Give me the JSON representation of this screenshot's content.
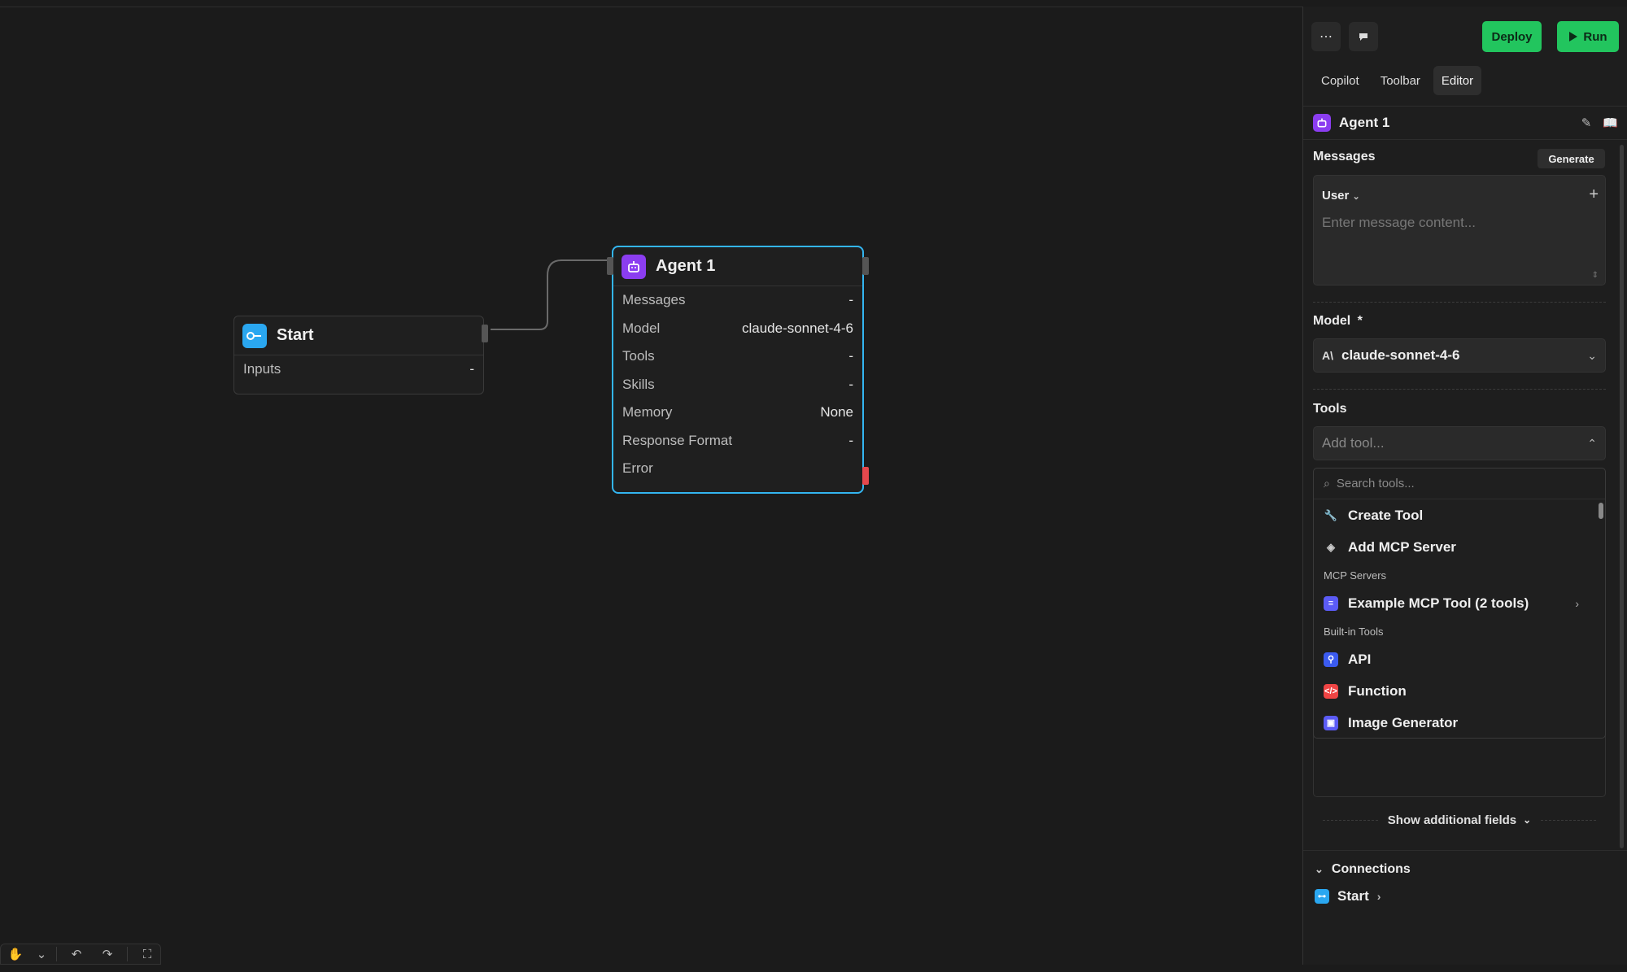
{
  "canvas": {
    "start_node": {
      "title": "Start",
      "rows": [
        {
          "label": "Inputs",
          "value": "-"
        }
      ]
    },
    "agent_node": {
      "title": "Agent 1",
      "rows": [
        {
          "label": "Messages",
          "value": "-"
        },
        {
          "label": "Model",
          "value": "claude-sonnet-4-6"
        },
        {
          "label": "Tools",
          "value": "-"
        },
        {
          "label": "Skills",
          "value": "-"
        },
        {
          "label": "Memory",
          "value": "None"
        },
        {
          "label": "Response Format",
          "value": "-"
        },
        {
          "label": "Error",
          "value": ""
        }
      ]
    }
  },
  "panel": {
    "top": {
      "deploy_label": "Deploy",
      "run_label": "Run"
    },
    "tabs": [
      {
        "label": "Copilot"
      },
      {
        "label": "Toolbar"
      },
      {
        "label": "Editor"
      }
    ],
    "active_tab": "Editor",
    "header": {
      "title": "Agent 1"
    },
    "messages": {
      "label": "Messages",
      "generate_label": "Generate",
      "role": "User",
      "placeholder": "Enter message content..."
    },
    "model": {
      "label": "Model",
      "required_mark": "*",
      "value": "claude-sonnet-4-6"
    },
    "tools": {
      "label": "Tools",
      "placeholder": "Add tool...",
      "search_placeholder": "Search tools...",
      "actions": [
        {
          "label": "Create Tool",
          "icon": "wrench-icon"
        },
        {
          "label": "Add MCP Server",
          "icon": "mcp-icon"
        }
      ],
      "mcp_section_label": "MCP Servers",
      "mcp_servers": [
        {
          "label": "Example MCP Tool (2 tools)"
        }
      ],
      "builtin_section_label": "Built-in Tools",
      "builtin_tools": [
        {
          "label": "API",
          "color": "#3b5bf0"
        },
        {
          "label": "Function",
          "color": "#ef4444"
        },
        {
          "label": "Image Generator",
          "color": "#5b5bf5"
        }
      ]
    },
    "show_additional_fields_label": "Show additional fields",
    "connections": {
      "label": "Connections",
      "items": [
        {
          "label": "Start"
        }
      ]
    }
  },
  "colors": {
    "accent_green": "#22c55e",
    "agent_purple": "#8b3df0",
    "start_blue": "#2aa7f0",
    "selection_border": "#33b5f0",
    "error_handle": "#e5484d"
  }
}
